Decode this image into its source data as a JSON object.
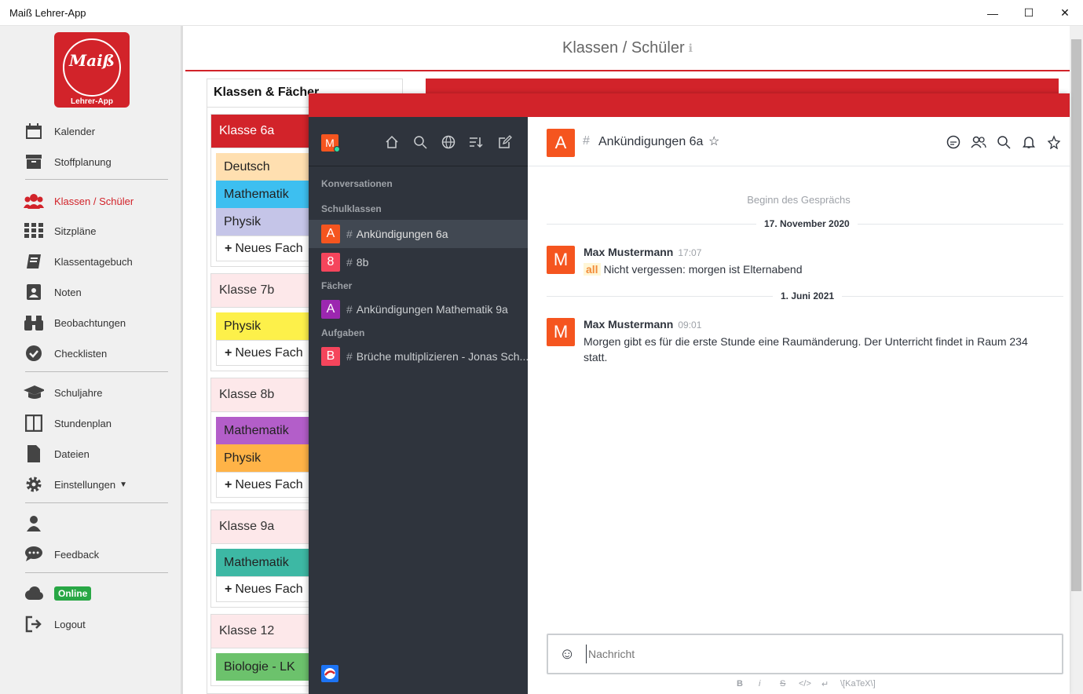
{
  "window": {
    "title": "Maiß Lehrer-App",
    "min": "—",
    "max": "☐",
    "close": "✕"
  },
  "logo": {
    "script": "Maiß",
    "sub": "Lehrer-App"
  },
  "nav": {
    "kalender": "Kalender",
    "stoffplanung": "Stoffplanung",
    "klassen": "Klassen / Schüler",
    "sitzplaene": "Sitzpläne",
    "klassentagebuch": "Klassentagebuch",
    "noten": "Noten",
    "beobachtungen": "Beobachtungen",
    "checklisten": "Checklisten",
    "schuljahre": "Schuljahre",
    "stundenplan": "Stundenplan",
    "dateien": "Dateien",
    "einstellungen": "Einstellungen",
    "feedback": "Feedback",
    "online": "Online",
    "logout": "Logout"
  },
  "header": {
    "title": "Klassen / Schüler",
    "info": "ℹ"
  },
  "panel": {
    "title": "Klassen & Fächer",
    "new_subject": "Neues Fach",
    "classes": [
      {
        "name": "Klasse 6a",
        "subjects": [
          {
            "name": "Deutsch",
            "color": "#ffdfb0"
          },
          {
            "name": "Mathematik",
            "color": "#3dbff0"
          },
          {
            "name": "Physik",
            "color": "#c5c5e8"
          }
        ]
      },
      {
        "name": "Klasse 7b",
        "subjects": [
          {
            "name": "Physik",
            "color": "#fdf04a"
          }
        ]
      },
      {
        "name": "Klasse 8b",
        "subjects": [
          {
            "name": "Mathematik",
            "color": "#b35ec9"
          },
          {
            "name": "Physik",
            "color": "#ffb347"
          }
        ]
      },
      {
        "name": "Klasse 9a",
        "subjects": [
          {
            "name": "Mathematik",
            "color": "#3db8a4"
          }
        ]
      },
      {
        "name": "Klasse 12",
        "subjects": [
          {
            "name": "Biologie - LK",
            "color": "#6cc26c"
          }
        ]
      }
    ]
  },
  "chat": {
    "user_initial": "M",
    "sections": {
      "conversations": "Konversationen",
      "schulklassen": "Schulklassen",
      "faecher": "Fächer",
      "aufgaben": "Aufgaben"
    },
    "rooms": {
      "r1": {
        "initial": "A",
        "name": "Ankündigungen 6a",
        "color": "#f5551f"
      },
      "r2": {
        "initial": "8",
        "name": "8b",
        "color": "#f5455c"
      },
      "r3": {
        "initial": "A",
        "name": "Ankündigungen Mathematik 9a",
        "color": "#9c27b0"
      },
      "r4": {
        "initial": "B",
        "name": "Brüche multiplizieren - Jonas Sch...",
        "color": "#f5455c"
      }
    },
    "room_title": "Ankündigungen 6a",
    "room_initial": "A",
    "start": "Beginn des Gesprächs",
    "date1": "17. November 2020",
    "date2": "1. Juni 2021",
    "messages": [
      {
        "initial": "M",
        "user": "Max Mustermann",
        "time": "17:07",
        "mention": "all",
        "text": "Nicht vergessen: morgen ist Elternabend"
      },
      {
        "initial": "M",
        "user": "Max Mustermann",
        "time": "09:01",
        "text": "Morgen gibt es für die erste Stunde eine Raumänderung. Der Unterricht findet in Raum 234 statt."
      }
    ],
    "composer_placeholder": "Nachricht",
    "format": {
      "bold": "B",
      "italic": "i",
      "strike": "S",
      "code": "</>",
      "enter": "↵",
      "katex": "\\[KaTeX\\]"
    }
  }
}
